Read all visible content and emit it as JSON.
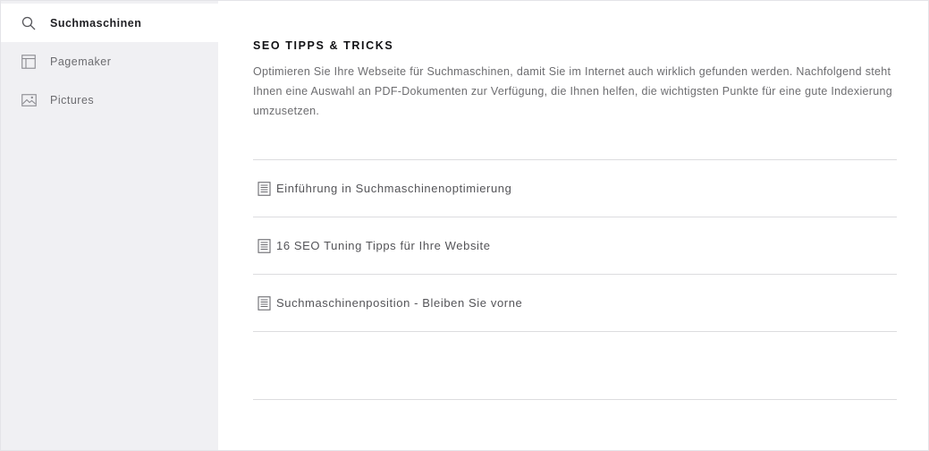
{
  "sidebar": {
    "items": [
      {
        "label": "Suchmaschinen",
        "icon": "search-icon",
        "active": true
      },
      {
        "label": "Pagemaker",
        "icon": "layout-icon",
        "active": false
      },
      {
        "label": "Pictures",
        "icon": "image-icon",
        "active": false
      }
    ]
  },
  "main": {
    "title": "SEO TIPPS & TRICKS",
    "description": "Optimieren Sie Ihre Webseite für Suchmaschinen, damit Sie im Internet auch wirklich gefunden werden. Nachfolgend steht Ihnen eine Auswahl an PDF-Dokumenten zur Verfügung, die Ihnen helfen, die wichtigsten Punkte für eine gute Indexierung umzusetzen.",
    "documents": [
      {
        "label": "Einführung in Suchmaschinenoptimierung",
        "icon": "document-icon"
      },
      {
        "label": "16 SEO Tuning Tipps für Ihre Website",
        "icon": "document-icon"
      },
      {
        "label": "Suchmaschinenposition - Bleiben Sie vorne",
        "icon": "document-icon"
      }
    ]
  },
  "colors": {
    "sidebar_bg": "#f0f0f3",
    "active_bg": "#ffffff",
    "divider": "#dcdcdf",
    "text_muted": "#6d6d70",
    "text_strong": "#111114"
  }
}
